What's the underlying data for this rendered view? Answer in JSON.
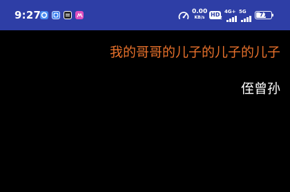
{
  "status_bar": {
    "time": "9:27",
    "notification_icons": [
      "baidu-app-icon",
      "browser-app-icon",
      "qq-music-icon",
      "ai-app-icon"
    ],
    "net_speed_value": "0.00",
    "net_speed_unit": "KB/s",
    "hd_badge": "HD",
    "hd_sub": "2",
    "signal1_label": "4G+",
    "signal2_label": "5G",
    "battery_level": "71",
    "bar_color": "#2e3ea6"
  },
  "content": {
    "relation_chain": "我的哥哥的儿子的儿子的儿子",
    "relation_result": "侄曾孙",
    "chain_color": "#e8712b",
    "result_color": "#ffffff"
  }
}
